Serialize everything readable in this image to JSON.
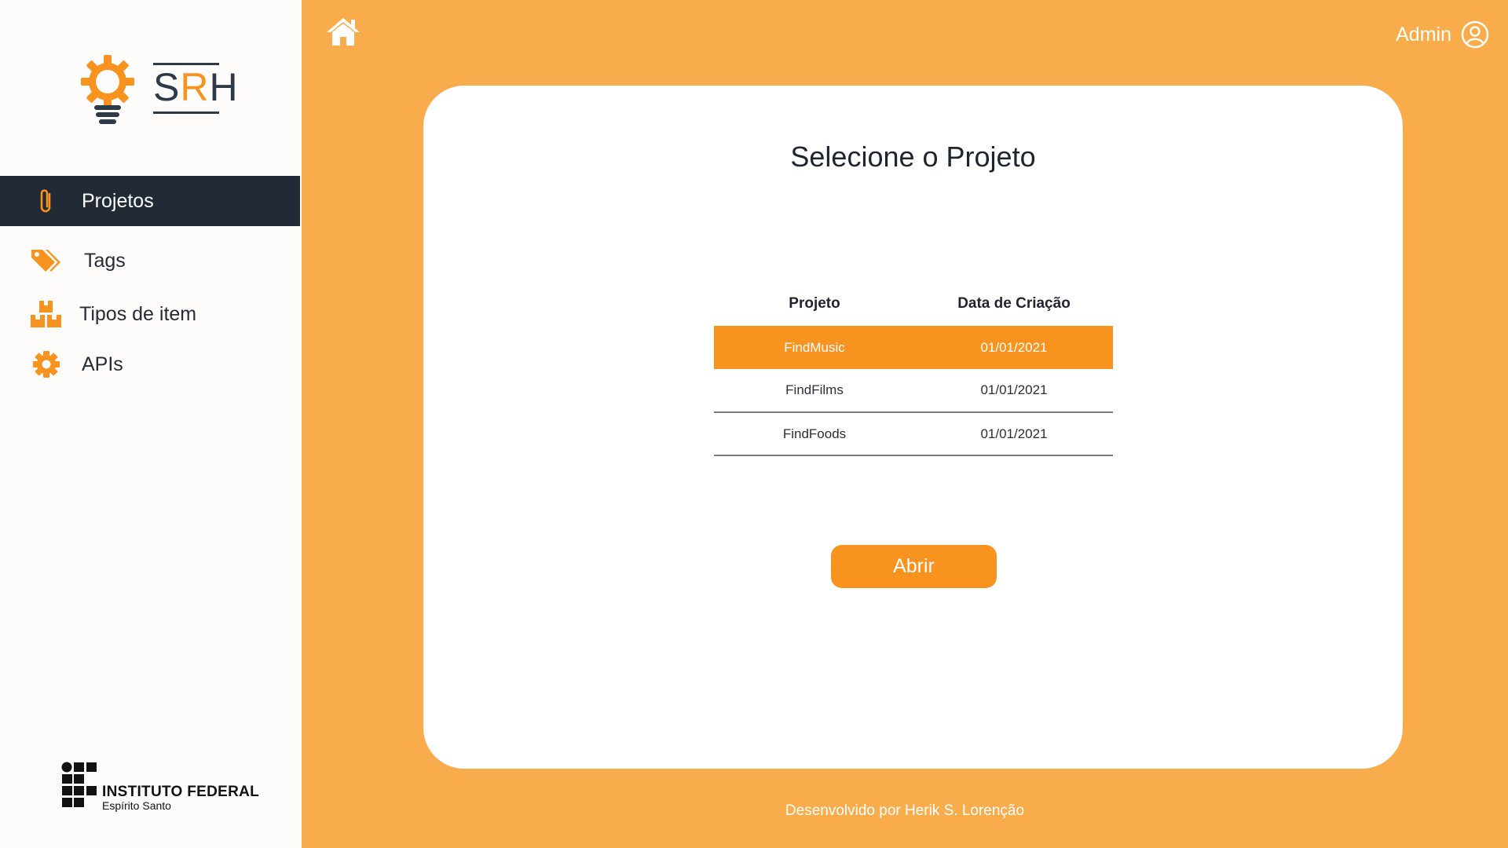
{
  "brand": {
    "logo_text_start": "S",
    "logo_text_accent": "R",
    "logo_text_end": "H",
    "accent_color": "#f7931e",
    "dark_color": "#222a35",
    "background_color": "#f9ac4c"
  },
  "sidebar": {
    "items": [
      {
        "label": "Projetos",
        "icon": "paperclip-icon",
        "active": true
      },
      {
        "label": "Tags",
        "icon": "tags-icon",
        "active": false
      },
      {
        "label": "Tipos de item",
        "icon": "boxes-icon",
        "active": false
      },
      {
        "label": "APIs",
        "icon": "gear-icon",
        "active": false
      }
    ],
    "institution": {
      "title": "INSTITUTO FEDERAL",
      "subtitle": "Espírito Santo"
    }
  },
  "header": {
    "home_icon": "home-icon",
    "user_name": "Admin",
    "user_icon": "user-circle-icon"
  },
  "main": {
    "title": "Selecione o Projeto",
    "table": {
      "columns": [
        "Projeto",
        "Data de Criação"
      ],
      "rows": [
        {
          "project": "FindMusic",
          "created": "01/01/2021",
          "selected": true
        },
        {
          "project": "FindFilms",
          "created": "01/01/2021",
          "selected": false
        },
        {
          "project": "FindFoods",
          "created": "01/01/2021",
          "selected": false
        }
      ]
    },
    "open_button": "Abrir"
  },
  "footer": {
    "text": "Desenvolvido por Herik S. Lorenção"
  }
}
